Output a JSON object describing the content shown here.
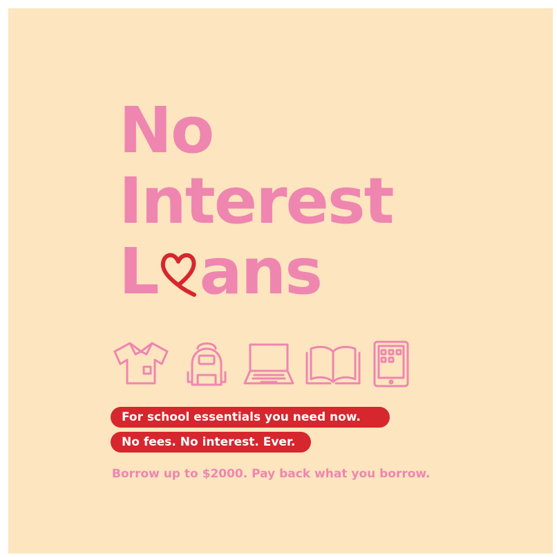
{
  "headline": {
    "line1": "No",
    "line2": "Interest",
    "line3_prefix": "L",
    "line3_suffix": "ans"
  },
  "icons": [
    "t-shirt-icon",
    "backpack-icon",
    "laptop-icon",
    "open-book-icon",
    "tablet-icon"
  ],
  "pills": {
    "line1": "For school essentials you need now.",
    "line2": "No fees. No interest. Ever."
  },
  "subtext": "Borrow up to $2000. Pay back what you borrow.",
  "colors": {
    "background": "#fde5bf",
    "headline_pink": "#ee86af",
    "accent_red": "#d6262e"
  }
}
